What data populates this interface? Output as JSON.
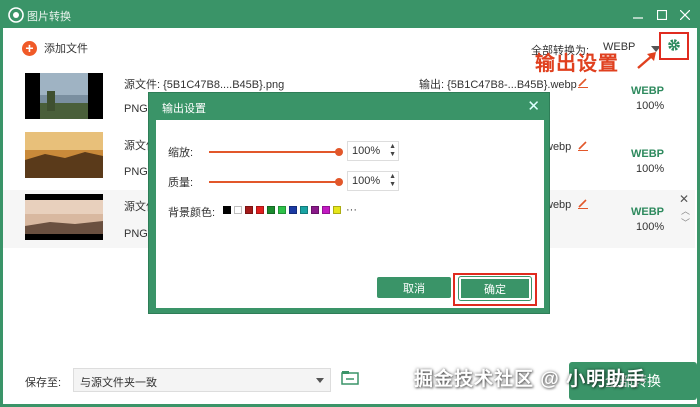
{
  "app": {
    "title": "图片转换"
  },
  "toolbar": {
    "add_label": "添加文件",
    "convert_all_label": "全部转换为:",
    "format_value": "WEBP",
    "annotation": "输出设置"
  },
  "files": [
    {
      "source": "源文件: {5B1C47B8....B45B}.png",
      "format": "PNG",
      "output": "输出: {5B1C47B8-...B45B}.webp",
      "status_format": "WEBP",
      "status_percent": "100%"
    },
    {
      "source": "源文件",
      "format": "PNG",
      "output": "webp",
      "status_format": "WEBP",
      "status_percent": "100%"
    },
    {
      "source": "源文件",
      "format": "PNG",
      "output": "webp",
      "status_format": "WEBP",
      "status_percent": "100%"
    }
  ],
  "bottom": {
    "save_label": "保存至:",
    "save_path": "与源文件夹一致",
    "convert_button": "全部转换"
  },
  "watermark": "掘金技术社区 @ 小明助手",
  "dialog": {
    "title": "输出设置",
    "scale_label": "缩放:",
    "scale_value": "100%",
    "quality_label": "质量:",
    "quality_value": "100%",
    "bg_label": "背景颜色:",
    "more": "···",
    "cancel": "取消",
    "ok": "确定"
  },
  "colors": {
    "accent": "#3a9468",
    "slider": "#e2572a",
    "highlight": "#e02b1f",
    "swatches": [
      "#000000",
      "#ffffff",
      "#a31a1a",
      "#e01f1f",
      "#1a8a2e",
      "#2ec24a",
      "#1a3aa3",
      "#1aa3a3",
      "#8a1a8a",
      "#c21ac2",
      "#e6e61a"
    ]
  }
}
